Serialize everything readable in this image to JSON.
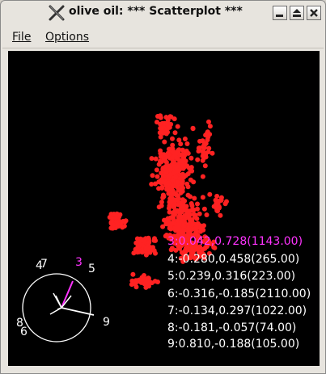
{
  "window": {
    "title": "olive oil: *** Scatterplot ***",
    "buttons": {
      "minimize": "minimize",
      "maximize": "maximize",
      "close": "close"
    }
  },
  "menu": {
    "file": "File",
    "options": "Options"
  },
  "plot": {
    "background": "#000000",
    "point_color": "#ff2222",
    "highlight_color": "#ff33ff",
    "text_color": "#ffffff"
  },
  "loadings": [
    {
      "id": "3",
      "text": "3:0.042,0.728(1143.00)",
      "highlighted": true
    },
    {
      "id": "4",
      "text": "4:-0.280,0.458(265.00)",
      "highlighted": false
    },
    {
      "id": "5",
      "text": "5:0.239,0.316(223.00)",
      "highlighted": false
    },
    {
      "id": "6",
      "text": "6:-0.316,-0.185(2110.00)",
      "highlighted": false
    },
    {
      "id": "7",
      "text": "7:-0.134,0.297(1022.00)",
      "highlighted": false
    },
    {
      "id": "8",
      "text": "8:-0.181,-0.057(74.00)",
      "highlighted": false
    },
    {
      "id": "9",
      "text": "9:0.810,-0.188(105.00)",
      "highlighted": false
    }
  ],
  "axis_labels": {
    "a3": "3",
    "a4": "4",
    "a5": "5",
    "a6": "6",
    "a7": "7",
    "a8": "8",
    "a9": "9"
  }
}
